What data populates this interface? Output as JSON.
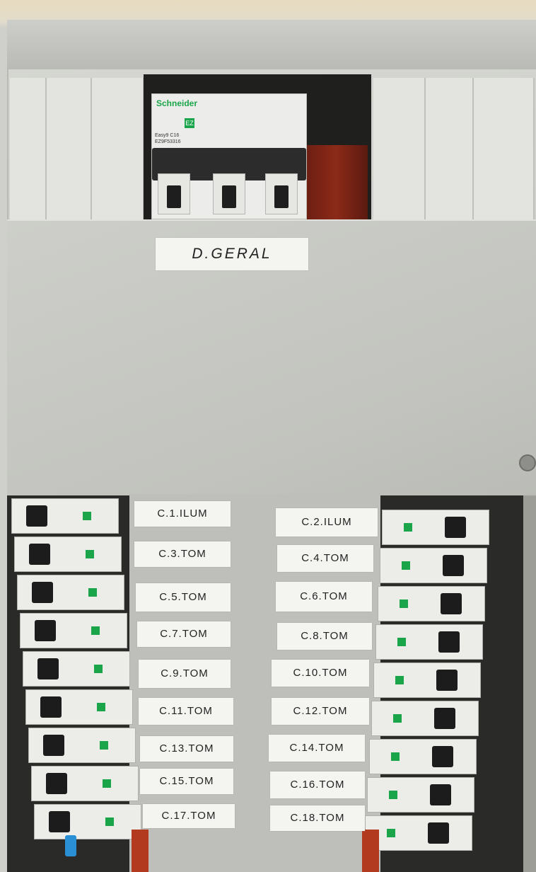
{
  "main_breaker": {
    "label": "D.GERAL",
    "brand": "Schneider",
    "rating_text": "Easy9 C16 EZ9F53316"
  },
  "left_labels": [
    "C.1.ILUM",
    "C.3.TOM",
    "C.5.TOM",
    "C.7.TOM",
    "C.9.TOM",
    "C.11.TOM",
    "C.13.TOM",
    "C.15.TOM",
    "C.17.TOM"
  ],
  "right_labels": [
    "C.2.ILUM",
    "C.4.TOM",
    "C.6.TOM",
    "C.8.TOM",
    "C.10.TOM",
    "C.12.TOM",
    "C.14.TOM",
    "C.16.TOM",
    "C.18.TOM"
  ],
  "colors": {
    "panel": "#c9cac5",
    "schneider_green": "#1aa54a",
    "busbar_red": "#8c2a18",
    "label_bg": "#f4f4f1"
  }
}
